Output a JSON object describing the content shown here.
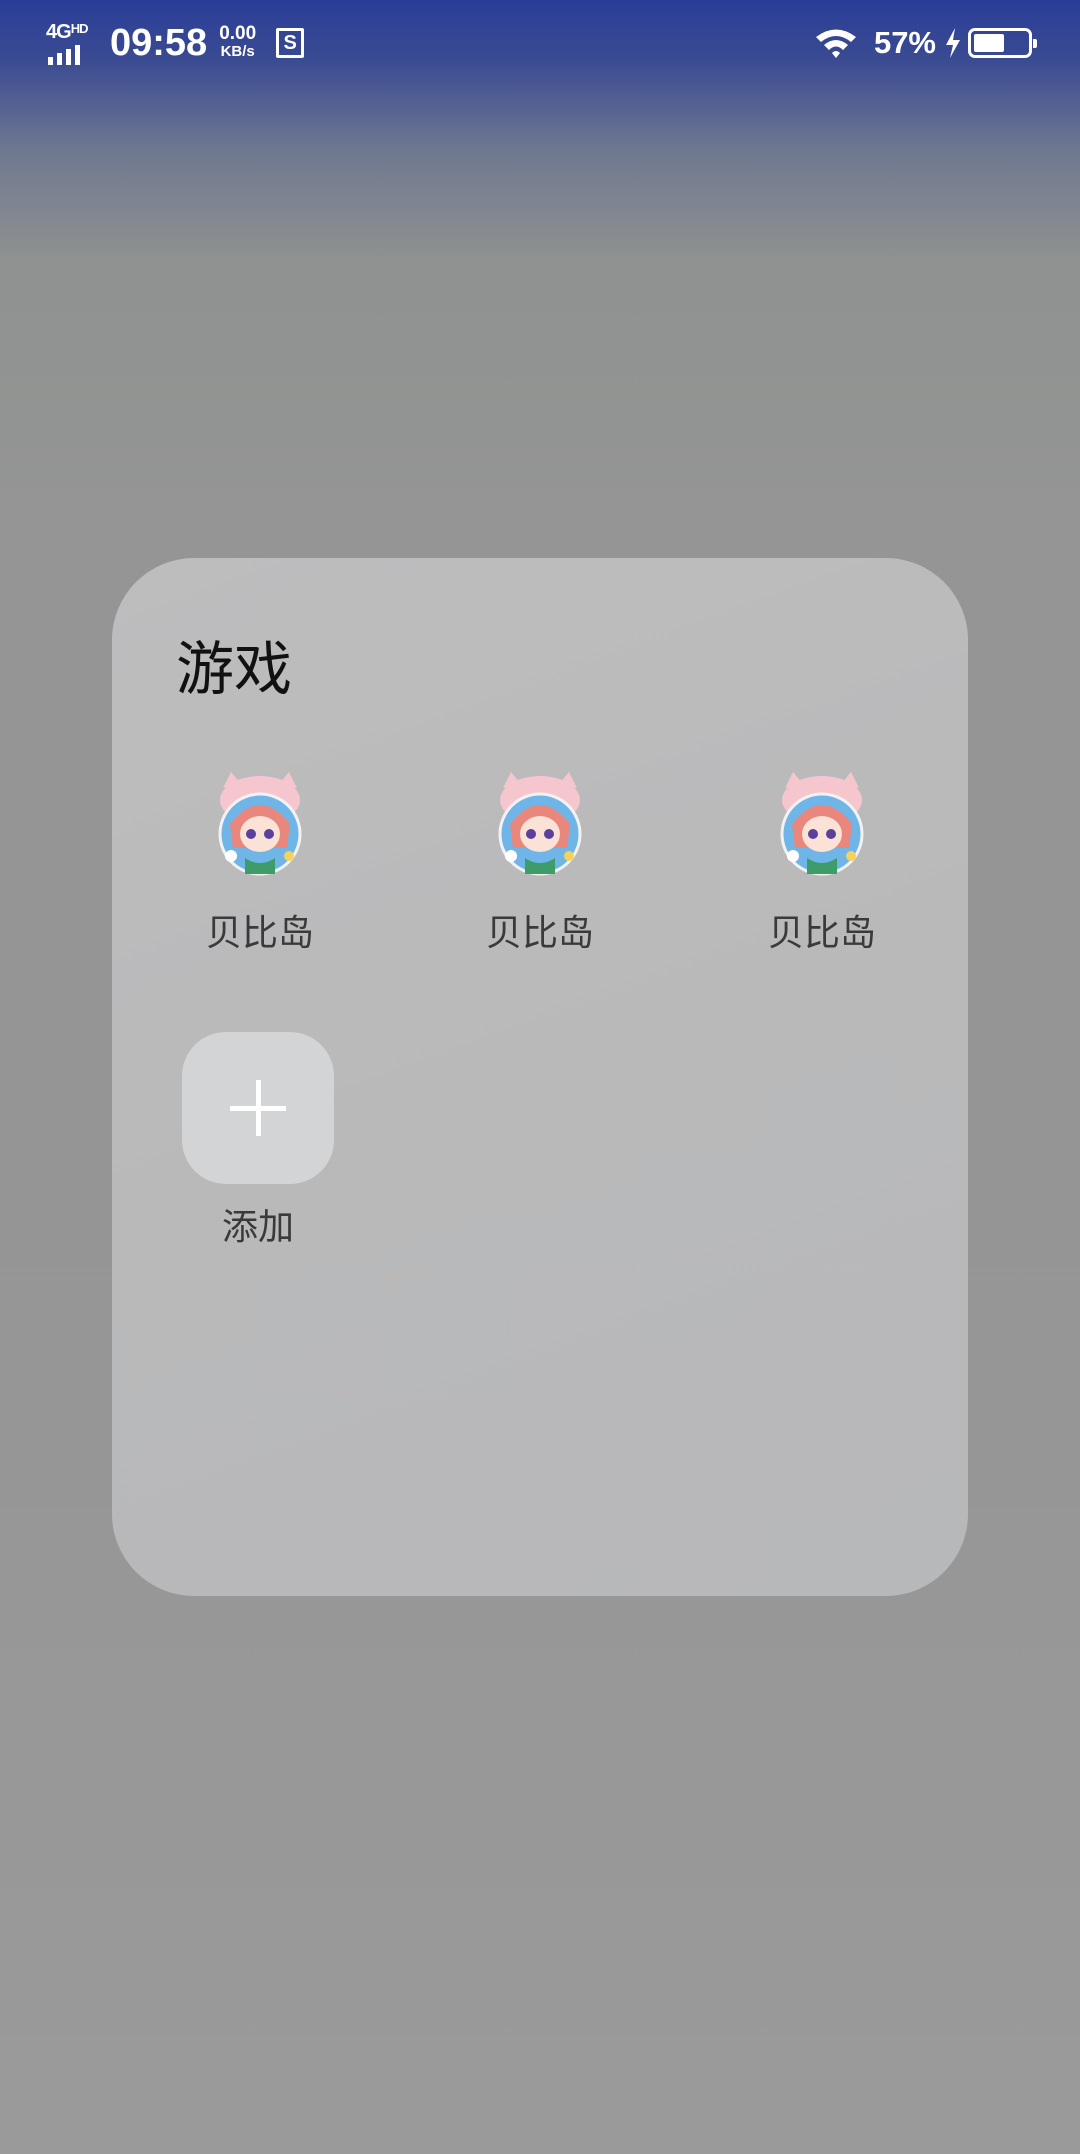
{
  "status_bar": {
    "network": "4G",
    "network_hd": "HD",
    "time": "09:58",
    "speed_value": "0.00",
    "speed_unit": "KB/s",
    "notification_icon_letter": "S",
    "battery_percent": "57%",
    "battery_level": 0.57,
    "charging": true
  },
  "folder": {
    "title": "游戏",
    "apps": [
      {
        "label": "贝比岛",
        "icon": "game-avatar-icon"
      },
      {
        "label": "贝比岛",
        "icon": "game-avatar-icon"
      },
      {
        "label": "贝比岛",
        "icon": "game-avatar-icon"
      }
    ],
    "add_label": "添加"
  },
  "colors": {
    "folder_bg": "#bcbcbd",
    "status_bar_top": "#2a3d97",
    "label_text": "#3a3a3a"
  }
}
